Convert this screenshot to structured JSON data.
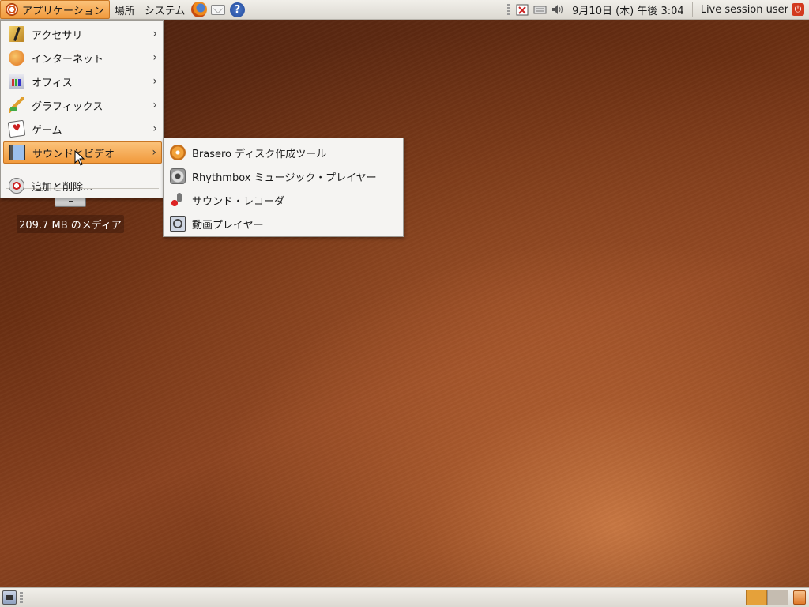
{
  "top_panel": {
    "menus": {
      "applications": "アプリケーション",
      "places": "場所",
      "system": "システム"
    },
    "launchers": [
      "firefox-icon",
      "mail-icon",
      "help-icon"
    ],
    "help_glyph": "?",
    "clock": "9月10日 (木) 午後 3:04",
    "user": "Live session user"
  },
  "applications_menu": {
    "items": [
      {
        "label": "アクセサリ",
        "icon": "accessories-icon",
        "has_submenu": true
      },
      {
        "label": "インターネット",
        "icon": "internet-icon",
        "has_submenu": true
      },
      {
        "label": "オフィス",
        "icon": "office-icon",
        "has_submenu": true
      },
      {
        "label": "グラフィックス",
        "icon": "graphics-icon",
        "has_submenu": true
      },
      {
        "label": "ゲーム",
        "icon": "games-icon",
        "has_submenu": true
      },
      {
        "label": "サウンドとビデオ",
        "icon": "sound-video-icon",
        "has_submenu": true,
        "highlighted": true
      }
    ],
    "add_remove": "追加と削除..."
  },
  "sound_video_submenu": {
    "items": [
      {
        "label": "Brasero ディスク作成ツール",
        "icon": "brasero-icon"
      },
      {
        "label": "Rhythmbox ミュージック・プレイヤー",
        "icon": "rhythmbox-icon"
      },
      {
        "label": "サウンド・レコーダ",
        "icon": "sound-recorder-icon"
      },
      {
        "label": "動画プレイヤー",
        "icon": "movie-player-icon"
      }
    ]
  },
  "desktop": {
    "drive_label": "209.7 MB のメディア"
  },
  "bottom_panel": {
    "workspaces": 2,
    "active_workspace": 1
  },
  "colors": {
    "highlight": "#f19a3c",
    "panel": "#dcd9d2",
    "wallpaper": "#7a3a18"
  }
}
